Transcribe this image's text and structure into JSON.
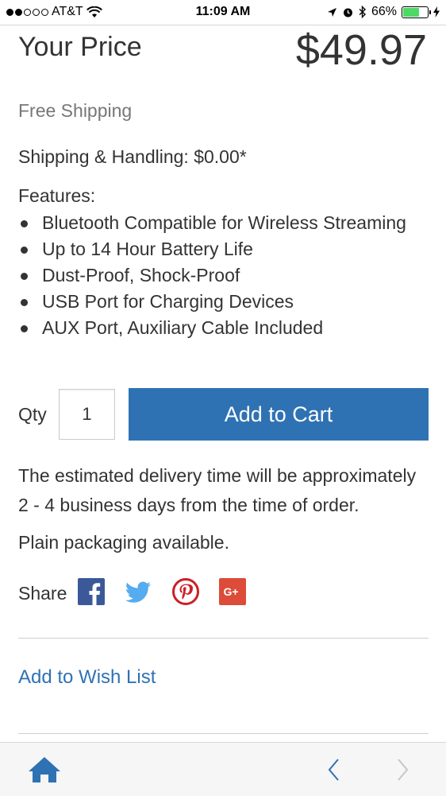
{
  "status_bar": {
    "carrier": "AT&T",
    "time": "11:09 AM",
    "battery_percent": "66%",
    "battery_level": 0.66,
    "signal_bars_filled": 2,
    "signal_bars_total": 5,
    "icons": [
      "wifi-icon",
      "location-icon",
      "alarm-icon",
      "bluetooth-icon",
      "battery-icon",
      "charging-icon"
    ]
  },
  "product": {
    "price_label": "Your Price",
    "price": "$49.97",
    "free_shipping": "Free Shipping",
    "shipping_handling": "Shipping & Handling: $0.00*",
    "features_title": "Features:",
    "features": [
      "Bluetooth Compatible for Wireless Streaming",
      "Up to 14 Hour Battery Life",
      "Dust-Proof, Shock-Proof",
      "USB Port for Charging Devices",
      "AUX Port, Auxiliary Cable Included"
    ]
  },
  "purchase": {
    "qty_label": "Qty",
    "qty_value": "1",
    "add_to_cart": "Add to Cart"
  },
  "info": {
    "delivery": "The estimated delivery time will be approximately 2 - 4 business days from the time of order.",
    "packaging": "Plain packaging available."
  },
  "share": {
    "label": "Share",
    "networks": [
      "facebook-icon",
      "twitter-icon",
      "pinterest-icon",
      "google-plus-icon"
    ]
  },
  "wishlist": {
    "label": "Add to Wish List"
  },
  "bottom_bar": {
    "icons": [
      "home-icon",
      "back-icon",
      "forward-icon"
    ]
  },
  "colors": {
    "accent": "#2f72b3",
    "facebook": "#3b5998",
    "twitter": "#55acee",
    "pinterest": "#cb2027",
    "google_plus": "#dd4b39",
    "battery_fill": "#4cd964"
  }
}
